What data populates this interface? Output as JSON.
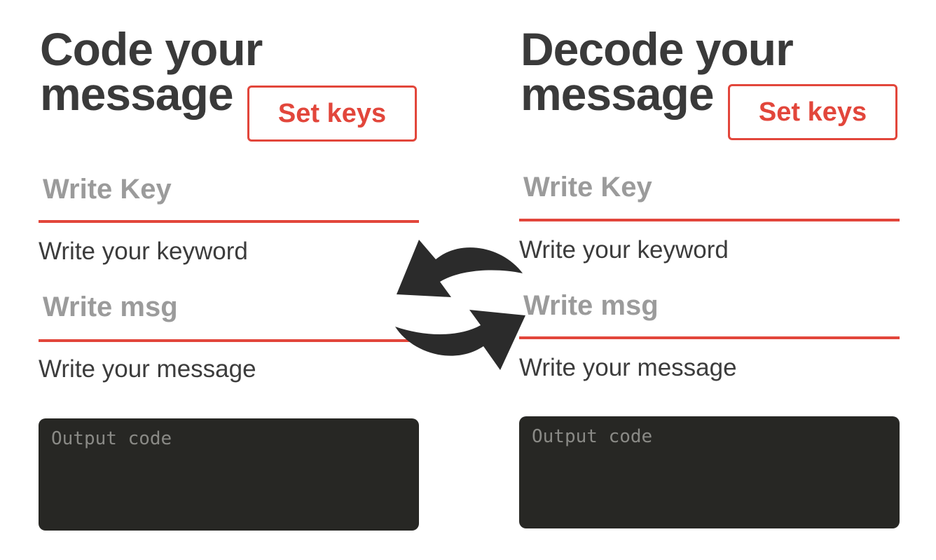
{
  "encode_panel": {
    "title": "Code your message",
    "set_keys_label": "Set keys",
    "key_label": "Write Key",
    "key_placeholder": "Write your keyword",
    "msg_label": "Write msg",
    "msg_placeholder": "Write your message",
    "output_placeholder": "Output code"
  },
  "decode_panel": {
    "title": "Decode your message",
    "set_keys_label": "Set keys",
    "key_label": "Write Key",
    "key_placeholder": "Write your keyword",
    "msg_label": "Write msg",
    "msg_placeholder": "Write your message",
    "output_placeholder": "Output code"
  },
  "swap_icon": "swap-arrows-icon",
  "colors": {
    "accent": "#e2463b",
    "title": "#3a3a3a",
    "label": "#9b9b9b",
    "output_bg": "#272724",
    "output_text": "#8a8a86"
  }
}
